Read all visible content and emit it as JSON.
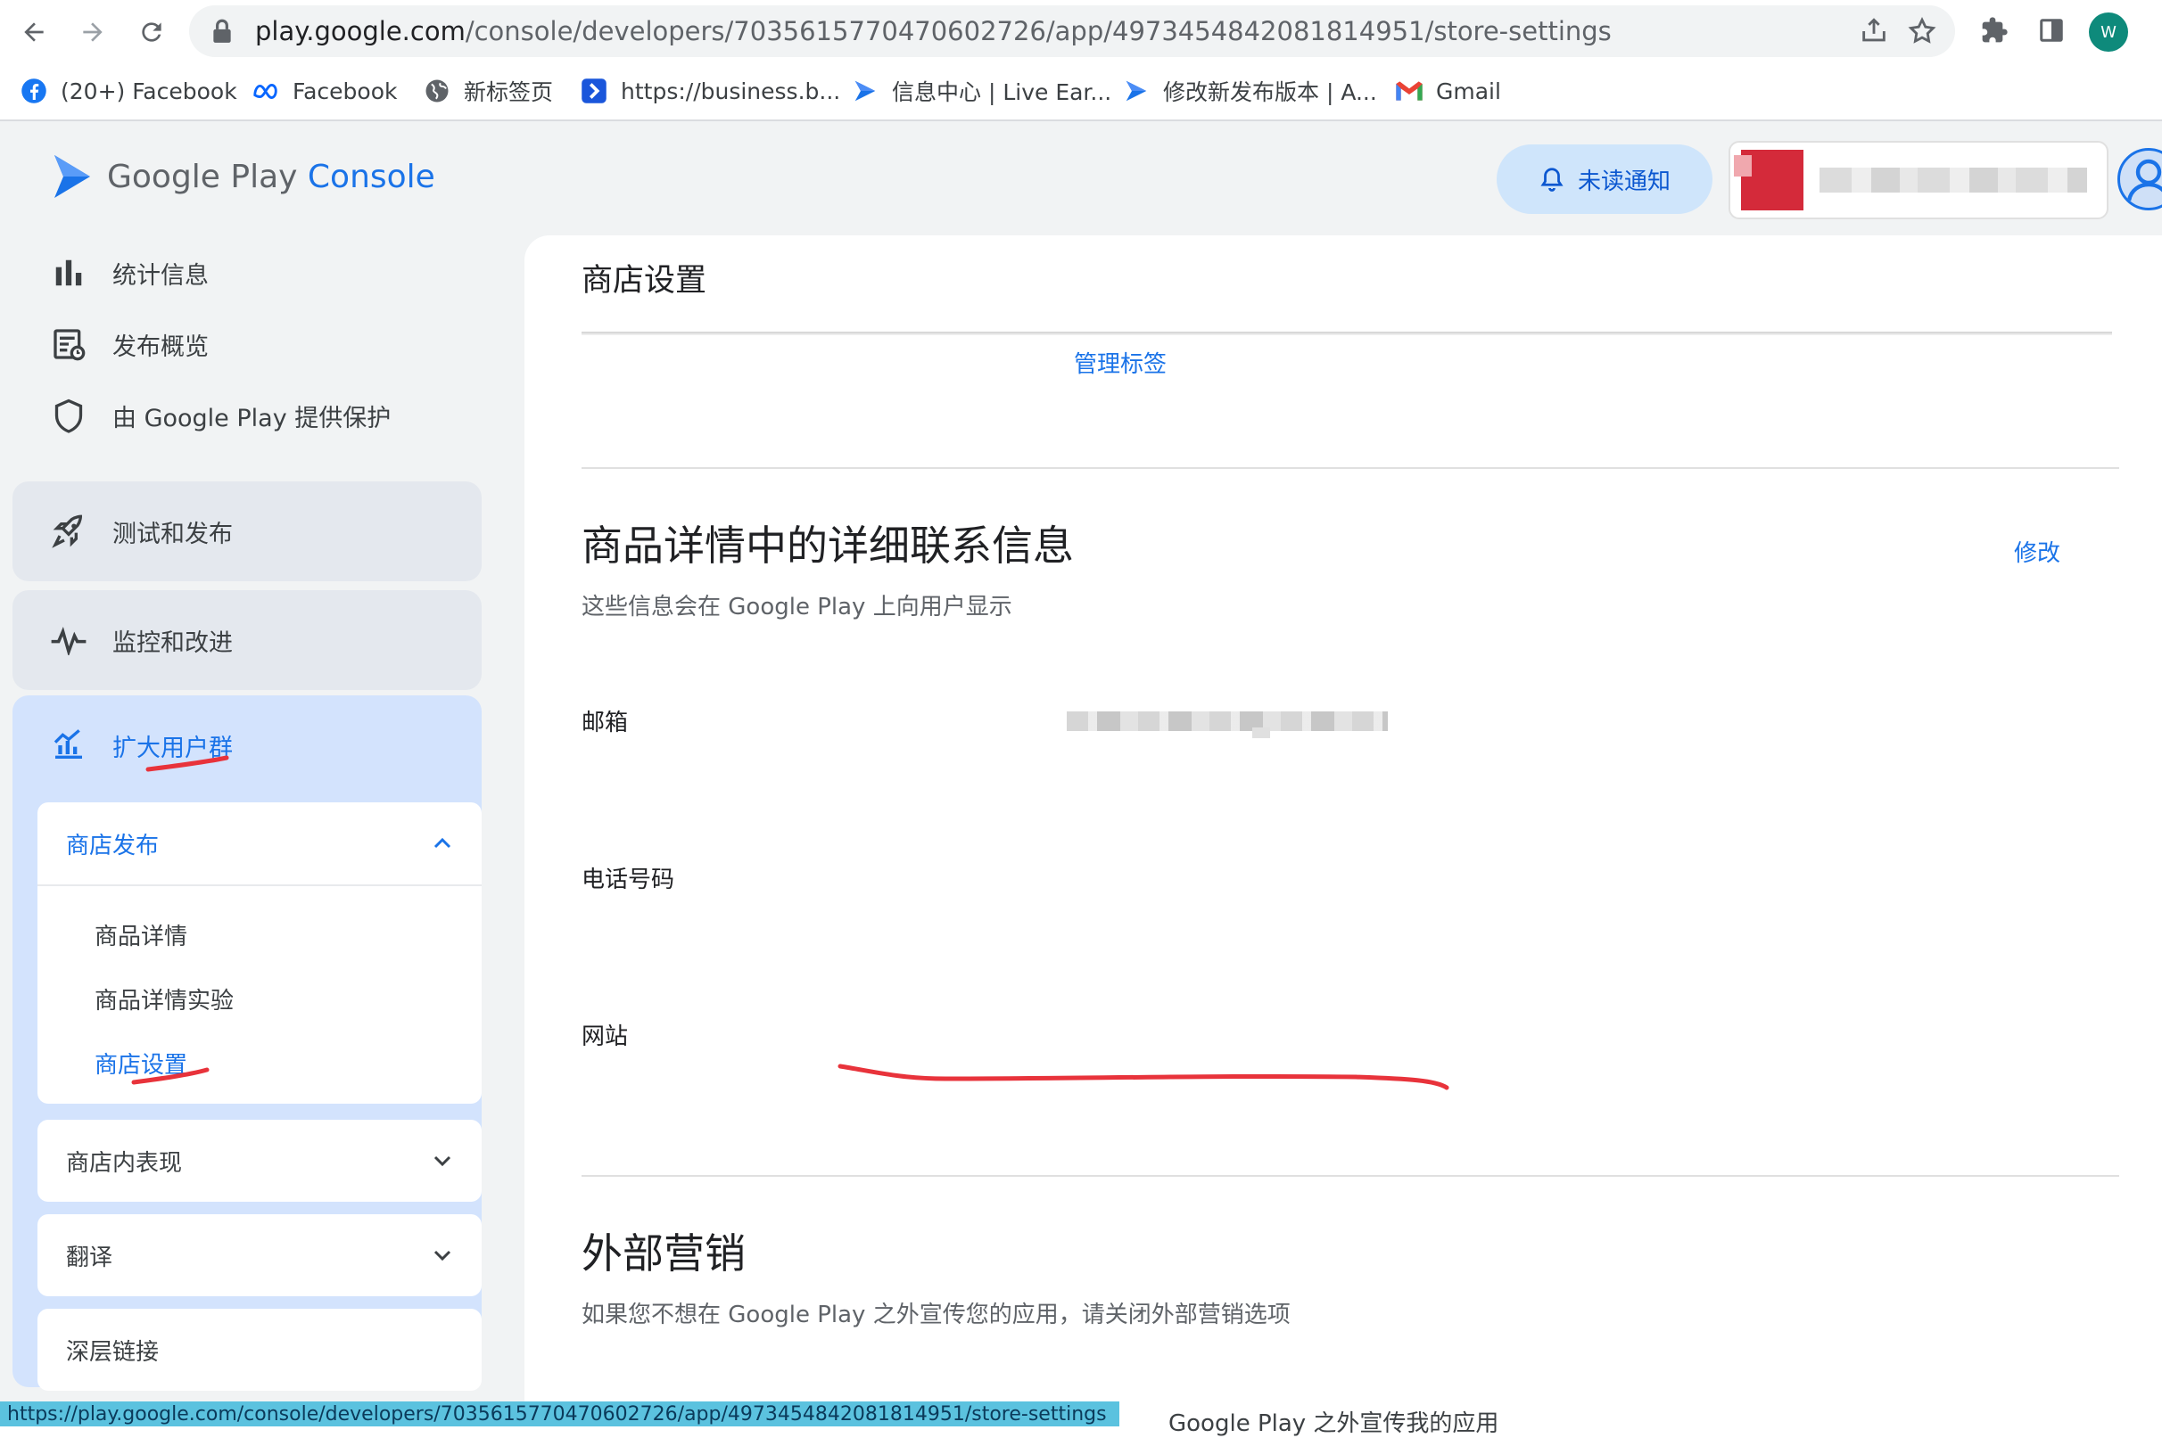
{
  "browser": {
    "url_host": "play.google.com",
    "url_path": "/console/developers/7035615770470602726/app/4973454842081814951/store-settings",
    "profile_initial": "W",
    "bookmarks": [
      {
        "label": "(20+) Facebook",
        "icon": "facebook-icon"
      },
      {
        "label": "Facebook",
        "icon": "meta-icon"
      },
      {
        "label": "新标签页",
        "icon": "globe-icon"
      },
      {
        "label": "https://business.b...",
        "icon": "bookmark-blue-icon"
      },
      {
        "label": "信息中心 | Live Ear...",
        "icon": "play-console-icon"
      },
      {
        "label": "修改新发布版本 | A...",
        "icon": "play-console-icon"
      },
      {
        "label": "Gmail",
        "icon": "gmail-icon"
      }
    ],
    "status_url": "https://play.google.com/console/developers/7035615770470602726/app/4973454842081814951/store-settings"
  },
  "header": {
    "logo_google_play": "Google Play",
    "logo_console": "Console",
    "notifications_label": "未读通知"
  },
  "sidebar": {
    "top_items": [
      {
        "label": "统计信息",
        "icon": "bar-chart-icon"
      },
      {
        "label": "发布概览",
        "icon": "publishing-overview-icon"
      },
      {
        "label": "由 Google Play 提供保护",
        "icon": "shield-icon"
      }
    ],
    "sections": [
      {
        "label": "测试和发布",
        "icon": "rocket-icon"
      },
      {
        "label": "监控和改进",
        "icon": "pulse-icon"
      }
    ],
    "expanded_section": {
      "label": "扩大用户群",
      "icon": "grow-users-icon",
      "store_presence": {
        "label": "商店发布",
        "items": [
          "商品详情",
          "商品详情实验",
          "商店设置"
        ],
        "active_item": "商店设置"
      },
      "collapsed_groups": [
        "商店内表现",
        "翻译"
      ],
      "deep_links": "深层链接"
    }
  },
  "main": {
    "page_title": "商店设置",
    "manage_tags_link": "管理标签",
    "contact_section": {
      "title": "商品详情中的详细联系信息",
      "edit_link": "修改",
      "description": "这些信息会在 Google Play 上向用户显示",
      "fields": {
        "email": "邮箱",
        "phone": "电话号码",
        "website": "网站"
      }
    },
    "external_marketing": {
      "title": "外部营销",
      "description": "如果您不想在 Google Play 之外宣传您的应用，请关闭外部营销选项",
      "option_partial": "Google Play 之外宣传我的应用"
    }
  },
  "colors": {
    "accent": "#1a73e8",
    "annotation": "#e8333b",
    "status_bar": "#5bc2df"
  }
}
